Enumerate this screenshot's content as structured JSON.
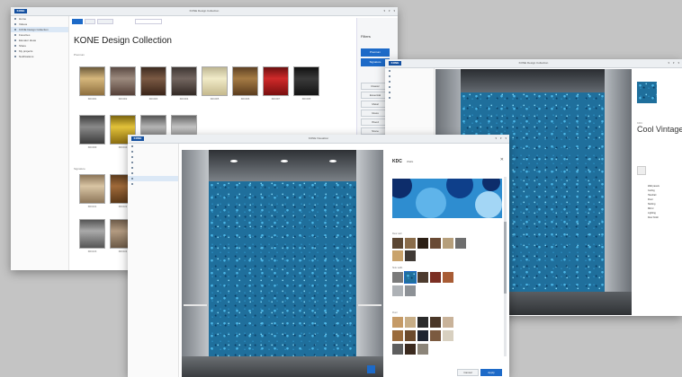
{
  "brand": {
    "logo": "KONE",
    "accent": "#1450a0",
    "link_blue": "#1d6ac8"
  },
  "win1": {
    "window_title": "KONE Design Collection",
    "nav": [
      "Home",
      "Videos",
      "KONE Design Collection",
      "Favorites",
      "Elevator ideas",
      "Share",
      "My projects",
      "Notifications"
    ],
    "heading": "KONE Design Collection",
    "section_1": "Premium",
    "section_2": "Signature",
    "captions": [
      "KDC001",
      "KDC002",
      "KDC003",
      "KDC004",
      "KDC005",
      "KDC006",
      "KDC007",
      "KDC008",
      "KDC009",
      "KDC010",
      "KDC011"
    ],
    "captions_2": [
      "KDC101",
      "KDC102",
      "KDC103",
      "KDC104",
      "KDC105",
      "KDC106"
    ],
    "filter_title": "Filters",
    "filter_buttons": [
      "Premium",
      "Signature",
      "Classic",
      "Essential",
      "Metal",
      "Glass",
      "Wood",
      "Stone"
    ]
  },
  "win2": {
    "window_title": "KONE Design Collection",
    "design_name": "Cool Vintage",
    "design_code": "KDC",
    "spec_lines": [
      "Wall panels",
      "Ceiling",
      "Handrail",
      "Floor",
      "Skirting",
      "Mirror",
      "Lighting",
      "Door finish"
    ]
  },
  "win3": {
    "window_title": "KONE Visualizer",
    "panel_title": "KDC",
    "panel_subtitle": "Walls",
    "section_labels": [
      "Rear wall",
      "Side walls",
      "Floor"
    ],
    "button_primary": "Apply",
    "button_secondary": "Cancel"
  }
}
